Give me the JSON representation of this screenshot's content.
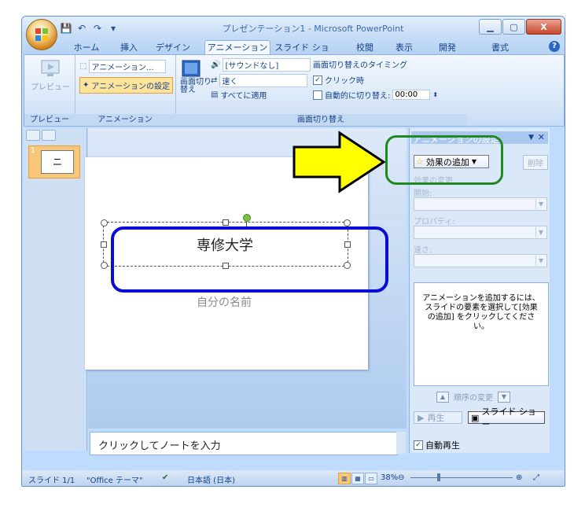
{
  "window": {
    "title": "プレゼンテーション1 - Microsoft PowerPoint",
    "minimize_icon": "minimize-icon",
    "maximize_icon": "maximize-icon",
    "close_label": "X"
  },
  "quick_access": {
    "icons": [
      "save-icon",
      "undo-icon",
      "redo-icon",
      "customize-icon"
    ]
  },
  "tabs": [
    {
      "label": "ホーム"
    },
    {
      "label": "挿入"
    },
    {
      "label": "デザイン"
    },
    {
      "label": "アニメーション",
      "active": true
    },
    {
      "label": "スライド ショー"
    },
    {
      "label": "校閲"
    },
    {
      "label": "表示"
    },
    {
      "label": "開発"
    },
    {
      "label": "書式"
    }
  ],
  "ribbon": {
    "preview": {
      "button": "プレビュー",
      "group": "プレビュー"
    },
    "animation": {
      "animate_dropdown": "アニメーション...",
      "custom_animation": "アニメーションの設定",
      "group": "アニメーション"
    },
    "transition": {
      "transition_button": "画面切り替え",
      "sound_dropdown": "[サウンドなし]",
      "speed_dropdown": "速く",
      "apply_all": "すべてに適用",
      "timing_title": "画面切り替えのタイミング",
      "on_click": "クリック時",
      "auto_after": "自動的に切り替え:",
      "auto_time": "00:00",
      "group": "画面切り替え"
    }
  },
  "thumbnails": {
    "slide_number": "1",
    "slide_text": "ニ"
  },
  "slide": {
    "title": "専修大学",
    "subtitle": "自分の名前"
  },
  "notes": {
    "placeholder": "クリックしてノートを入力"
  },
  "task_pane": {
    "title": "アニメーションの設定",
    "add_effect": "効果の追加",
    "delete": "削除",
    "change_effect": "効果の変更",
    "start_label": "開始:",
    "property_label": "プロパティ:",
    "speed_label": "速さ:",
    "hint": "アニメーションを追加するには、スライドの要素を選択して[効果の追加] をクリックしてください。",
    "reorder": "順序の変更",
    "play": "再生",
    "slideshow": "スライド ショー",
    "autopreview": "自動再生"
  },
  "status": {
    "slide": "スライド 1/1",
    "theme": "\"Office テーマ\"",
    "language": "日本語 (日本)",
    "zoom": "38%"
  },
  "colors": {
    "highlight_arrow": "#ffff00",
    "green_box": "#1f8a1f",
    "blue_box": "#0b0bd6"
  }
}
